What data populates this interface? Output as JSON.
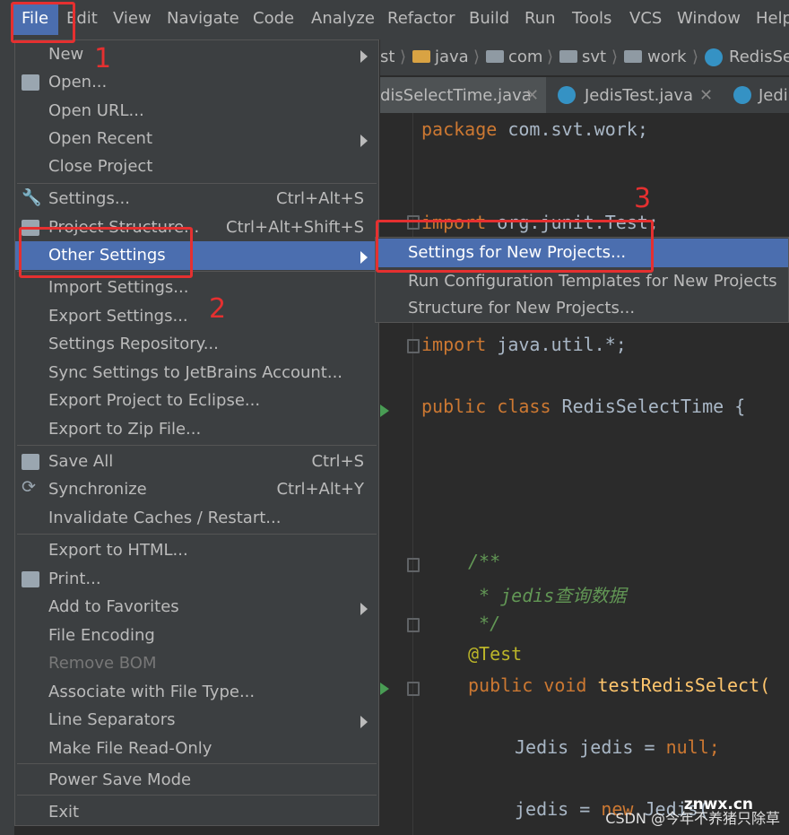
{
  "menubar": {
    "items": [
      "File",
      "Edit",
      "View",
      "Navigate",
      "Code",
      "Analyze",
      "Refactor",
      "Build",
      "Run",
      "Tools",
      "VCS",
      "Window",
      "Help"
    ]
  },
  "breadcrumbs": [
    "st",
    "java",
    "com",
    "svt",
    "work",
    "RedisSe"
  ],
  "tabs": [
    "disSelectTime.java",
    "JedisTest.java",
    "Jedi"
  ],
  "file_menu": {
    "items": [
      {
        "label": "New",
        "submenu": true
      },
      {
        "label": "Open..."
      },
      {
        "label": "Open URL..."
      },
      {
        "label": "Open Recent",
        "submenu": true
      },
      {
        "label": "Close Project"
      },
      {
        "label": "Settings...",
        "shortcut": "Ctrl+Alt+S"
      },
      {
        "label": "Project Structure...",
        "shortcut": "Ctrl+Alt+Shift+S"
      },
      {
        "label": "Other Settings",
        "submenu": true
      },
      {
        "label": "Import Settings..."
      },
      {
        "label": "Export Settings..."
      },
      {
        "label": "Settings Repository..."
      },
      {
        "label": "Sync Settings to JetBrains Account..."
      },
      {
        "label": "Export Project to Eclipse..."
      },
      {
        "label": "Export to Zip File..."
      },
      {
        "label": "Save All",
        "shortcut": "Ctrl+S"
      },
      {
        "label": "Synchronize",
        "shortcut": "Ctrl+Alt+Y"
      },
      {
        "label": "Invalidate Caches / Restart..."
      },
      {
        "label": "Export to HTML..."
      },
      {
        "label": "Print..."
      },
      {
        "label": "Add to Favorites",
        "submenu": true
      },
      {
        "label": "File Encoding"
      },
      {
        "label": "Remove BOM"
      },
      {
        "label": "Associate with File Type..."
      },
      {
        "label": "Line Separators",
        "submenu": true
      },
      {
        "label": "Make File Read-Only"
      },
      {
        "label": "Power Save Mode"
      },
      {
        "label": "Exit"
      }
    ]
  },
  "other_settings_submenu": [
    "Settings for New Projects...",
    "Run Configuration Templates for New Projects",
    "Structure for New Projects..."
  ],
  "code": {
    "l1_kw": "package",
    "l1_rest": " com.svt.work;",
    "l2_kw": "import",
    "l2_rest": " org.junit.Test;",
    "l3_kw": "import",
    "l3_rest": " java.util.*;",
    "l4_kw1": "public",
    "l4_kw2": " class",
    "l4_rest": " RedisSelectTime {",
    "c1": "/**",
    "c2": " * jedis查询数据",
    "c3": " */",
    "ann": "@Test",
    "l5_kw1": "public",
    "l5_kw2": " void",
    "l5_fn": " testRedisSelect(",
    "l6_rest": "Jedis jedis = ",
    "l6_null": "null",
    "l6_end": ";",
    "l7_rest": "jedis = ",
    "l7_new": "new",
    "l7_end": " Jedis("
  },
  "annotations": [
    "1",
    "2",
    "3"
  ],
  "watermark": {
    "site": "znwx.cn",
    "credit": "CSDN @今年不养猪只除草"
  },
  "colors": {
    "selection": "#4b6eaf",
    "menu_bg": "#3c3f41",
    "editor_bg": "#2b2b2b",
    "highlight_box": "#e53030"
  }
}
